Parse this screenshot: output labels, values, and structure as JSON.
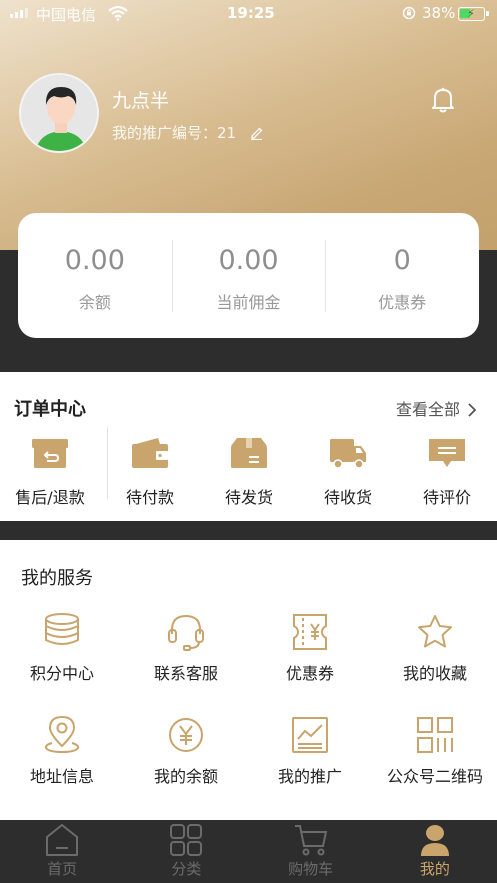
{
  "status_bar": {
    "carrier": "中国电信",
    "time": "19:25",
    "battery": "38%"
  },
  "profile": {
    "nickname": "九点半",
    "promo_label": "我的推广编号：",
    "promo_code": "21"
  },
  "stats": [
    {
      "value": "0.00",
      "label": "余额"
    },
    {
      "value": "0.00",
      "label": "当前佣金"
    },
    {
      "value": "0",
      "label": "优惠券"
    }
  ],
  "orders": {
    "title": "订单中心",
    "view_all": "查看全部",
    "items": [
      {
        "label": "售后/退款",
        "icon": "refund-box-icon"
      },
      {
        "label": "待付款",
        "icon": "wallet-icon"
      },
      {
        "label": "待发货",
        "icon": "package-box-icon"
      },
      {
        "label": "待收货",
        "icon": "delivery-truck-icon"
      },
      {
        "label": "待评价",
        "icon": "comment-icon"
      }
    ]
  },
  "services": {
    "title": "我的服务",
    "items": [
      {
        "label": "积分中心",
        "icon": "coins-stack-icon"
      },
      {
        "label": "联系客服",
        "icon": "headset-icon"
      },
      {
        "label": "优惠券",
        "icon": "coupon-icon"
      },
      {
        "label": "我的收藏",
        "icon": "star-icon"
      },
      {
        "label": "地址信息",
        "icon": "location-pin-icon"
      },
      {
        "label": "我的余额",
        "icon": "yen-coin-icon"
      },
      {
        "label": "我的推广",
        "icon": "chart-board-icon"
      },
      {
        "label": "公众号二维码",
        "icon": "qr-code-icon"
      }
    ]
  },
  "tabbar": [
    {
      "label": "首页",
      "icon": "home-icon",
      "active": false
    },
    {
      "label": "分类",
      "icon": "category-grid-icon",
      "active": false
    },
    {
      "label": "购物车",
      "icon": "cart-icon",
      "active": false
    },
    {
      "label": "我的",
      "icon": "user-icon",
      "active": true
    }
  ],
  "colors": {
    "accent": "#c9a46c",
    "dark": "#2e2d2d",
    "header_gradient_end": "#c19f6a"
  }
}
